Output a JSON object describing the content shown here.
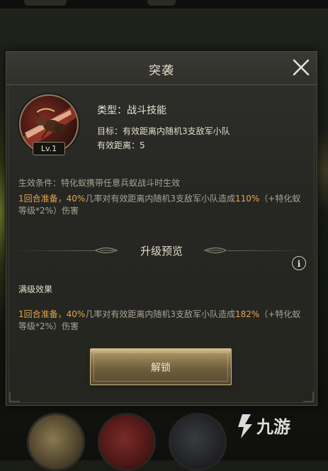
{
  "dialog": {
    "title": "突袭",
    "close_icon": "close-icon"
  },
  "skill": {
    "level_badge": "Lv.1",
    "type_line": "类型：战斗技能",
    "target_line": "目标：有效距离内随机3支敌军小队",
    "range_line": "有效距离：5",
    "condition_line": "生效条件：特化蚁携带任意兵蚁战斗时生效",
    "effect_current": {
      "part1": "1回合准备，",
      "pct": "40%",
      "part2": "几率对有效距离内随机3支敌军小队造成",
      "dmg": "110%",
      "part3": "（+特化蚁等级*2%）伤害"
    }
  },
  "upgrade": {
    "section_title": "升级预览",
    "info_icon": "i",
    "max_title": "满级效果",
    "effect_max": {
      "part1": "1回合准备，",
      "pct": "40%",
      "part2": "几率对有效距离内随机3支敌军小队造成",
      "dmg": "182%",
      "part3": "（+特化蚁等级*2%）伤害"
    }
  },
  "actions": {
    "unlock_label": "解锁"
  },
  "colors": {
    "highlight": "#e6a54e",
    "body_text": "#a9a394",
    "title_text": "#e4ddcb"
  },
  "watermark": {
    "text": "九游"
  }
}
